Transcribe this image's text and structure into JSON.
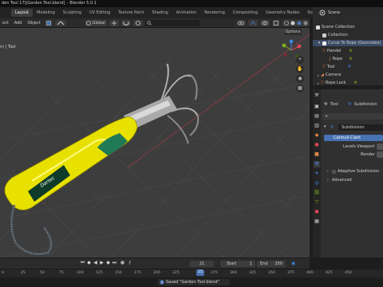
{
  "window": {
    "title_file": "den Tool 17\\[Garden Tool.blend]",
    "title_app": "Blender 5.0.1"
  },
  "workspaces": [
    "Layout",
    "Modeling",
    "Sculpting",
    "UV Editing",
    "Texture Paint",
    "Shading",
    "Animation",
    "Rendering",
    "Compositing",
    "Geometry Nodes",
    "Scripting"
  ],
  "active_workspace": "Layout",
  "scene_tab": {
    "label": "Scene"
  },
  "header": {
    "menus": [
      "ect",
      "Add",
      "Object"
    ],
    "orientation": "Global",
    "search_icon": "search-icon"
  },
  "viewport": {
    "label": "n) | Tool",
    "options_label": "Options",
    "product_logo_text": "Dartec",
    "handle_color": "#e8e100",
    "grip_color": "#1f7a55",
    "bg_color": "#3d3d3d"
  },
  "outliner": {
    "rows": [
      {
        "label": "Scene Collection",
        "type": "scene"
      },
      {
        "label": "Collection",
        "type": "collection"
      },
      {
        "label": "Curve To Rope (Geonodes)",
        "type": "collection"
      },
      {
        "label": "Handel",
        "type": "object"
      },
      {
        "label": "Rope",
        "type": "object"
      },
      {
        "label": "Tool",
        "type": "object"
      },
      {
        "label": "Camera",
        "type": "camera"
      },
      {
        "label": "Rope Lock",
        "type": "object"
      }
    ]
  },
  "properties": {
    "object_name": "Tool",
    "modifier_tab": "Subdivision",
    "modifier_name": "Subdivision",
    "mode_button": "Catmull-Clark",
    "levels_viewport_label": "Levels Viewport",
    "render_label": "Render",
    "adaptive_label": "Adaptive Subdivision",
    "advanced_label": "Advanced"
  },
  "timeline": {
    "current_frame": "21",
    "start_label": "Start",
    "start_value": "1",
    "end_label": "End",
    "end_value": "250"
  },
  "ruler": {
    "ticks": [
      "0",
      "25",
      "50",
      "75",
      "100",
      "125",
      "150",
      "175",
      "200",
      "225",
      "250",
      "275",
      "300",
      "325",
      "350",
      "375",
      "400",
      "425",
      "450"
    ],
    "current": "25"
  },
  "status": {
    "message": "Saved \"Garden Tool.blend\""
  },
  "colors": {
    "accent": "#4772b3",
    "selection": "#3b4a66",
    "gizmo_x": "#e04456",
    "gizmo_y": "#7fb21c",
    "gizmo_z": "#3d86e0"
  }
}
